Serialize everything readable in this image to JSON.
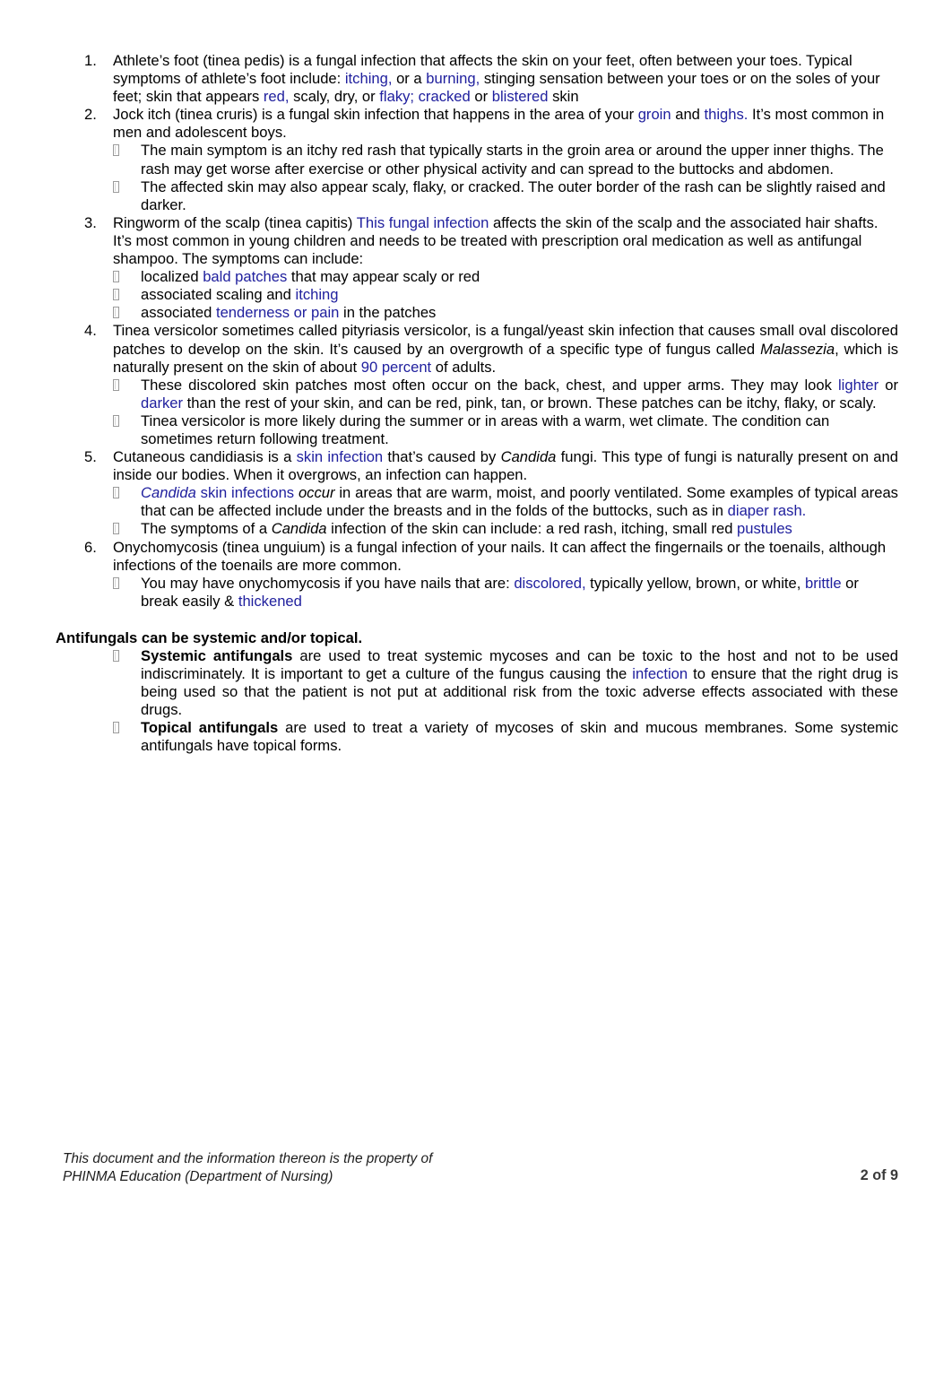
{
  "document": {
    "page_label": "2 of 9",
    "link_color": "#20209e",
    "text_color": "#000000"
  },
  "list": {
    "items": [
      {
        "number": "1.",
        "segments": [
          {
            "t": "Athlete’s foot (tinea pedis) is a fungal infection that affects the skin on your feet, often between your toes. Typical symptoms of athlete’s foot include: ",
            "s": "plain"
          },
          {
            "t": "itching,",
            "s": "link"
          },
          {
            "t": " or a ",
            "s": "plain"
          },
          {
            "t": "burning,",
            "s": "link"
          },
          {
            "t": " stinging sensation between your toes or on the soles of your feet; skin that appears ",
            "s": "plain"
          },
          {
            "t": "red,",
            "s": "link"
          },
          {
            "t": " scaly, dry, or ",
            "s": "plain"
          },
          {
            "t": "flaky; cracked",
            "s": "link"
          },
          {
            "t": " or ",
            "s": "plain"
          },
          {
            "t": "blistered",
            "s": "link"
          },
          {
            "t": " skin",
            "s": "plain"
          }
        ],
        "subitems": []
      },
      {
        "number": "2.",
        "segments": [
          {
            "t": "Jock itch (tinea cruris) is a fungal skin infection that happens in the area of your ",
            "s": "plain"
          },
          {
            "t": "groin",
            "s": "link"
          },
          {
            "t": " and ",
            "s": "plain"
          },
          {
            "t": "thighs.",
            "s": "link"
          },
          {
            "t": " It’s most common in men and adolescent boys.",
            "s": "plain"
          }
        ],
        "subitems": [
          {
            "segments": [
              {
                "t": "The main symptom is an itchy red rash that typically starts in the groin area or around the upper inner thighs. The rash may get worse after exercise or other physical activity and can spread to the buttocks and abdomen.",
                "s": "plain"
              }
            ]
          },
          {
            "segments": [
              {
                "t": "The affected skin may also appear scaly, flaky, or cracked. The outer border of the rash can be slightly raised and darker.",
                "s": "plain"
              }
            ]
          }
        ]
      },
      {
        "number": "3.",
        "segments": [
          {
            "t": "Ringworm of the scalp (tinea capitis) ",
            "s": "plain"
          },
          {
            "t": "This fungal infection",
            "s": "link"
          },
          {
            "t": " affects the skin of the scalp and the associated hair shafts. It’s most common in young children and needs to be treated with prescription oral medication as well as antifungal shampoo. The symptoms can include:",
            "s": "plain"
          }
        ],
        "subitems": [
          {
            "segments": [
              {
                "t": "localized ",
                "s": "plain"
              },
              {
                "t": "bald patches",
                "s": "link"
              },
              {
                "t": " that may appear scaly or red",
                "s": "plain"
              }
            ]
          },
          {
            "segments": [
              {
                "t": "associated scaling and ",
                "s": "plain"
              },
              {
                "t": "itching",
                "s": "link"
              }
            ]
          },
          {
            "segments": [
              {
                "t": "associated ",
                "s": "plain"
              },
              {
                "t": "tenderness or pain",
                "s": "link"
              },
              {
                "t": " in the patches",
                "s": "plain"
              }
            ]
          }
        ]
      },
      {
        "number": "4.",
        "justify": true,
        "segments": [
          {
            "t": "Tinea versicolor sometimes called pityriasis versicolor, is a fungal/yeast skin infection that causes small oval discolored patches to develop on the skin. It’s caused by an overgrowth of a specific type of fungus called ",
            "s": "plain"
          },
          {
            "t": "Malassezia",
            "s": "italic"
          },
          {
            "t": ", which is naturally present on the skin of about ",
            "s": "plain"
          },
          {
            "t": "90 percent",
            "s": "link"
          },
          {
            "t": " of adults.",
            "s": "plain"
          }
        ],
        "subitems": [
          {
            "justify": true,
            "segments": [
              {
                "t": "These discolored skin patches most often occur on the back, chest, and upper arms. They may look  ",
                "s": "plain"
              },
              {
                "t": "lighter",
                "s": "link"
              },
              {
                "t": " or ",
                "s": "plain"
              },
              {
                "t": "darker",
                "s": "link"
              },
              {
                "t": " than the rest of your skin, and can be red, pink, tan, or brown. These patches can be itchy, flaky, or scaly.",
                "s": "plain"
              }
            ]
          },
          {
            "segments": [
              {
                "t": "Tinea versicolor is more likely during the summer or in areas with a warm, wet climate. The condition can sometimes return following treatment.",
                "s": "plain"
              }
            ]
          }
        ]
      },
      {
        "number": "5.",
        "justify": true,
        "segments": [
          {
            "t": "Cutaneous candidiasis is a ",
            "s": "plain"
          },
          {
            "t": "skin infection",
            "s": "link"
          },
          {
            "t": " that’s caused by ",
            "s": "plain"
          },
          {
            "t": "Candida",
            "s": "italic"
          },
          {
            "t": " fungi. This type of fungi is naturally present on and inside our bodies. When it overgrows, an infection can happen.",
            "s": "plain"
          }
        ],
        "subitems": [
          {
            "justify": true,
            "segments": [
              {
                "t": "Candida",
                "s": "link-italic"
              },
              {
                "t": " skin infections",
                "s": "link"
              },
              {
                "t": " ",
                "s": "plain"
              },
              {
                "t": "occur",
                "s": "italic"
              },
              {
                "t": " in areas that are warm, moist, and poorly ventilated. Some examples of typical areas that can be affected include under the breasts and in the folds of the buttocks, such as in ",
                "s": "plain"
              },
              {
                "t": "diaper rash.",
                "s": "link"
              }
            ]
          },
          {
            "segments": [
              {
                "t": "The symptoms of a ",
                "s": "plain"
              },
              {
                "t": "Candida",
                "s": "italic"
              },
              {
                "t": " infection of the skin can include: a red rash, itching, small red ",
                "s": "plain"
              },
              {
                "t": "pustules",
                "s": "link"
              }
            ]
          }
        ]
      },
      {
        "number": "6.",
        "segments": [
          {
            "t": "Onychomycosis (tinea unguium) is a fungal infection of your nails. It can affect the fingernails or the toenails, although infections of the toenails are more common.",
            "s": "plain"
          }
        ],
        "subitems": [
          {
            "segments": [
              {
                "t": "You may have onychomycosis if you have nails that are: ",
                "s": "plain"
              },
              {
                "t": "discolored,",
                "s": "link"
              },
              {
                "t": " typically yellow, brown, or white, ",
                "s": "plain"
              },
              {
                "t": "brittle",
                "s": "link"
              },
              {
                "t": " or break easily & ",
                "s": "plain"
              },
              {
                "t": "thickened",
                "s": "link"
              }
            ]
          }
        ]
      }
    ]
  },
  "antifungals": {
    "heading": "Antifungals can be systemic and/or topical.",
    "items": [
      {
        "justify": true,
        "segments": [
          {
            "t": "Systemic antifungals",
            "s": "bold"
          },
          {
            "t": " are used to treat systemic mycoses and can be toxic to the host and not to be used indiscriminately. It is important to get a culture of the fungus causing the ",
            "s": "plain"
          },
          {
            "t": "infection",
            "s": "link"
          },
          {
            "t": " to ensure that the right drug is being used so that the patient is not put at additional risk from the toxic adverse effects associated with these drugs.",
            "s": "plain"
          }
        ]
      },
      {
        "justify": true,
        "segments": [
          {
            "t": "Topical antifungals",
            "s": "bold"
          },
          {
            "t": " are used to treat a variety of mycoses of skin and mucous membranes. Some systemic antifungals have topical forms.",
            "s": "plain"
          }
        ]
      }
    ]
  },
  "footer": {
    "line1": "This document and the information thereon is the property of",
    "line2": "PHINMA Education (Department of Nursing)",
    "page": "2 of 9"
  }
}
